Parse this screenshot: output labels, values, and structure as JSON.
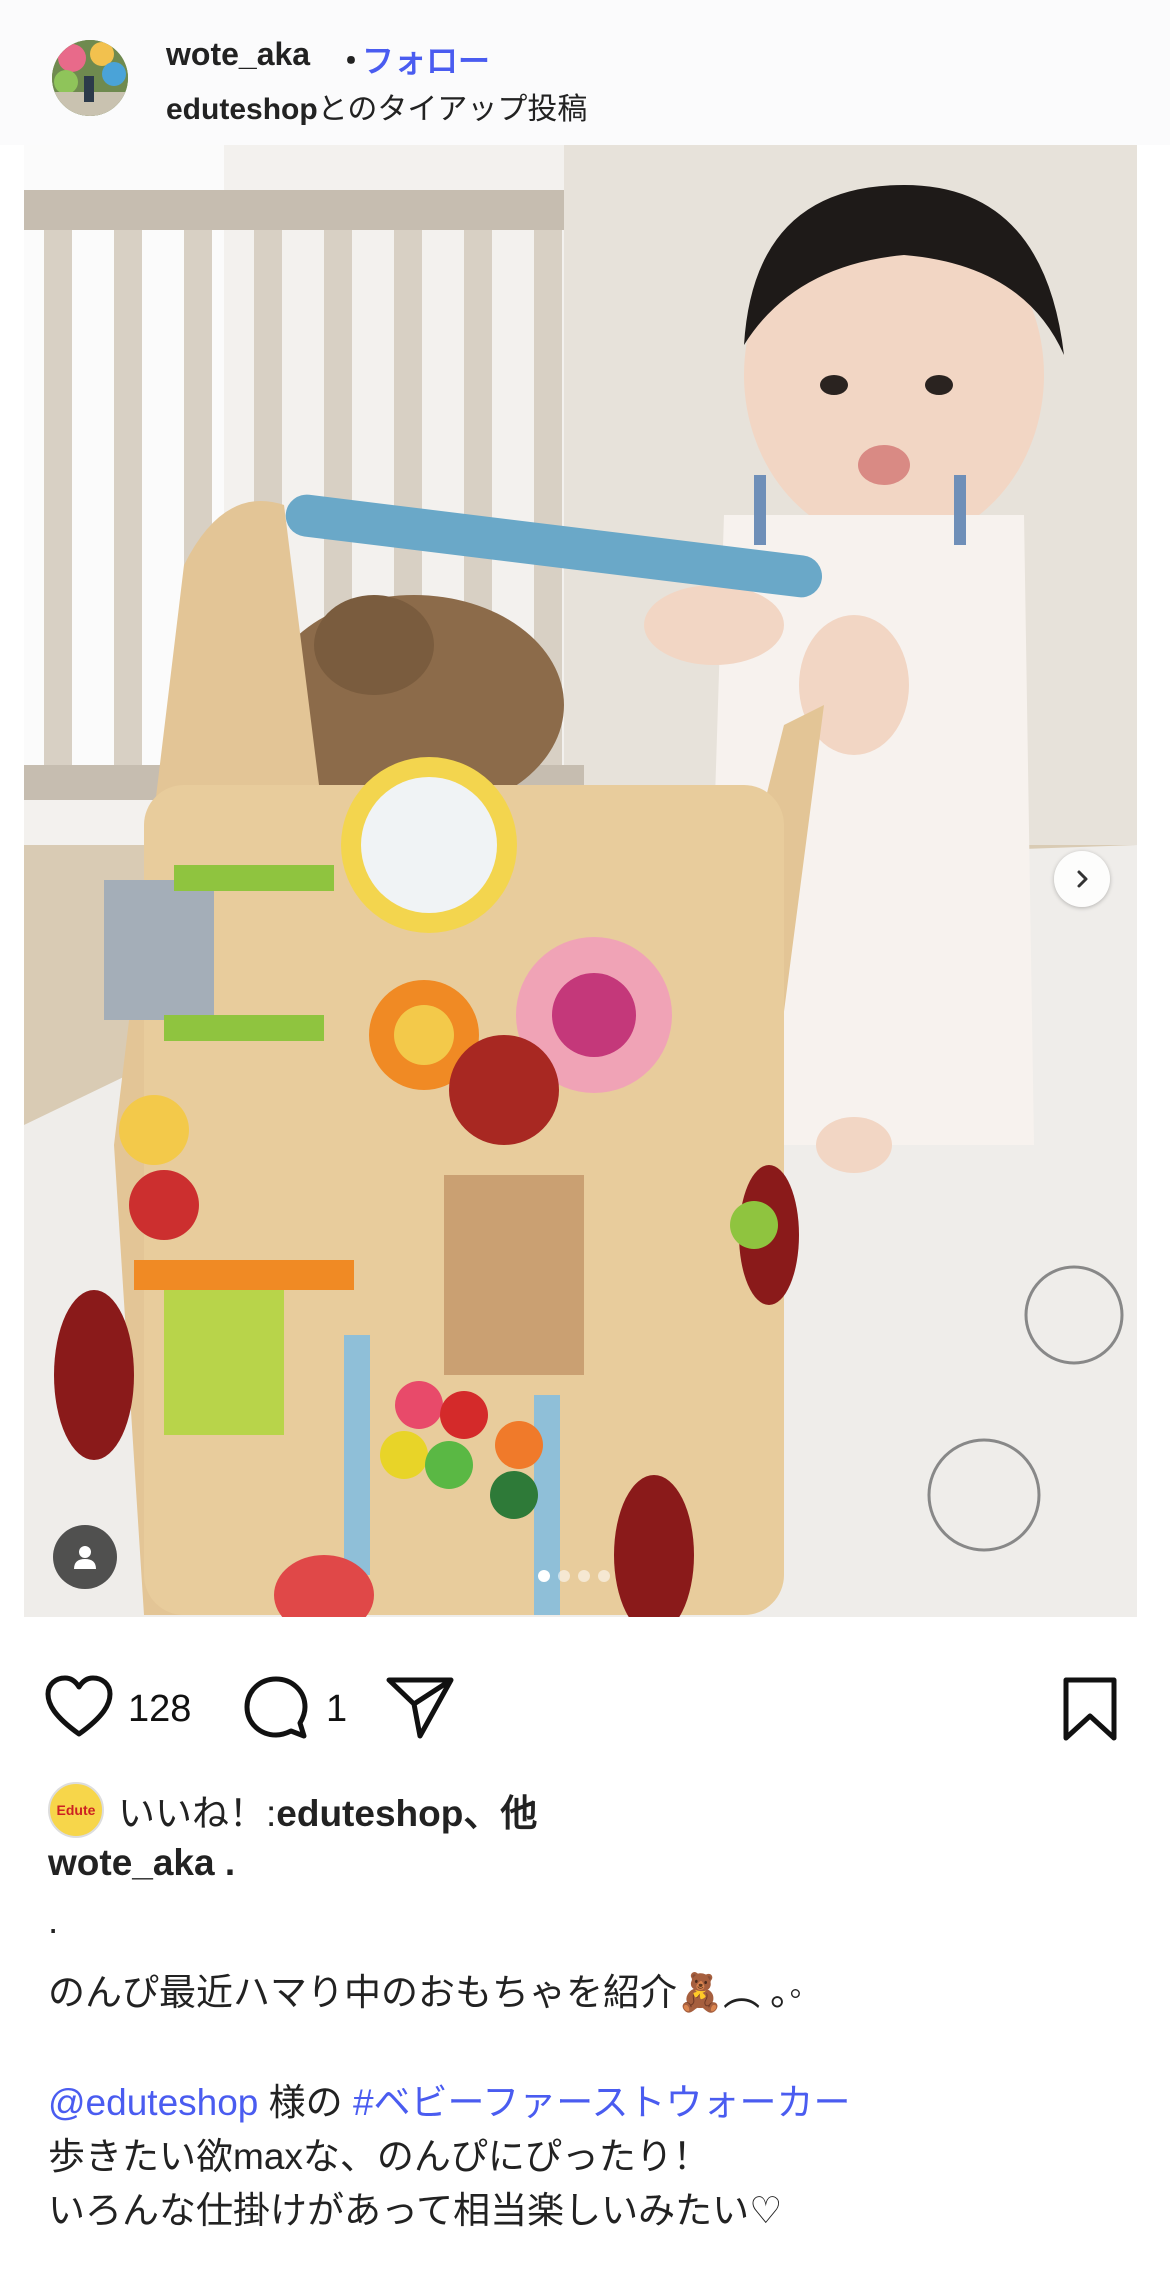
{
  "header": {
    "username": "wote_aka",
    "separator": "・",
    "follow_label": "フォロー",
    "partner": "eduteshop",
    "tieup_suffix": "とのタイアップ投稿"
  },
  "carousel": {
    "slide_count": 4,
    "active_slide": 1,
    "next_icon": "chevron-right-icon",
    "tag_icon": "person-icon"
  },
  "actions": {
    "like_icon": "heart-icon",
    "like_count": "128",
    "comment_icon": "comment-icon",
    "comment_count": "1",
    "share_icon": "send-icon",
    "save_icon": "bookmark-icon"
  },
  "likes_line": {
    "prefix": "いいね！: ",
    "liked_by": "eduteshop、他",
    "badge_text": "Edute"
  },
  "caption": {
    "author": "wote_aka",
    "author_suffix": " .",
    "line_dot": ".",
    "line1": "のんぴ最近ハマり中のおもちゃを紹介🧸︵ ｡◦",
    "mention": "@eduteshop",
    "mention_suffix": " 様の ",
    "hashtag": "#ベビーファーストウォーカー",
    "line3": "歩きたい欲maxな、のんぴにぴったり！",
    "line4": "いろんな仕掛けがあって相当楽しいみたい♡"
  },
  "colors": {
    "link": "#4a5cf0",
    "text": "#222222"
  }
}
